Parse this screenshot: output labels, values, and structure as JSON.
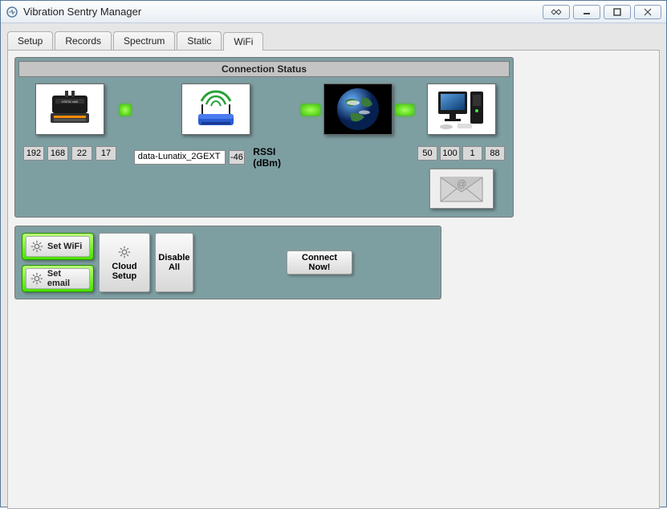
{
  "window": {
    "title": "Vibration Sentry Manager"
  },
  "tabs": [
    {
      "label": "Setup"
    },
    {
      "label": "Records"
    },
    {
      "label": "Spectrum"
    },
    {
      "label": "Static"
    },
    {
      "label": "WiFi"
    }
  ],
  "active_tab": 4,
  "status": {
    "header": "Connection Status",
    "device_ip": [
      "192",
      "168",
      "22",
      "17"
    ],
    "ssid": "data-Lunatix_2GEXT",
    "rssi_value": "-46",
    "rssi_label": "RSSI (dBm)",
    "server_ip": [
      "50",
      "100",
      "1",
      "88"
    ]
  },
  "buttons": {
    "set_wifi": "Set WiFi",
    "set_email": "Set email",
    "cloud_setup": "Cloud Setup",
    "disable_all": "Disable All",
    "connect_now": "Connect Now!"
  }
}
